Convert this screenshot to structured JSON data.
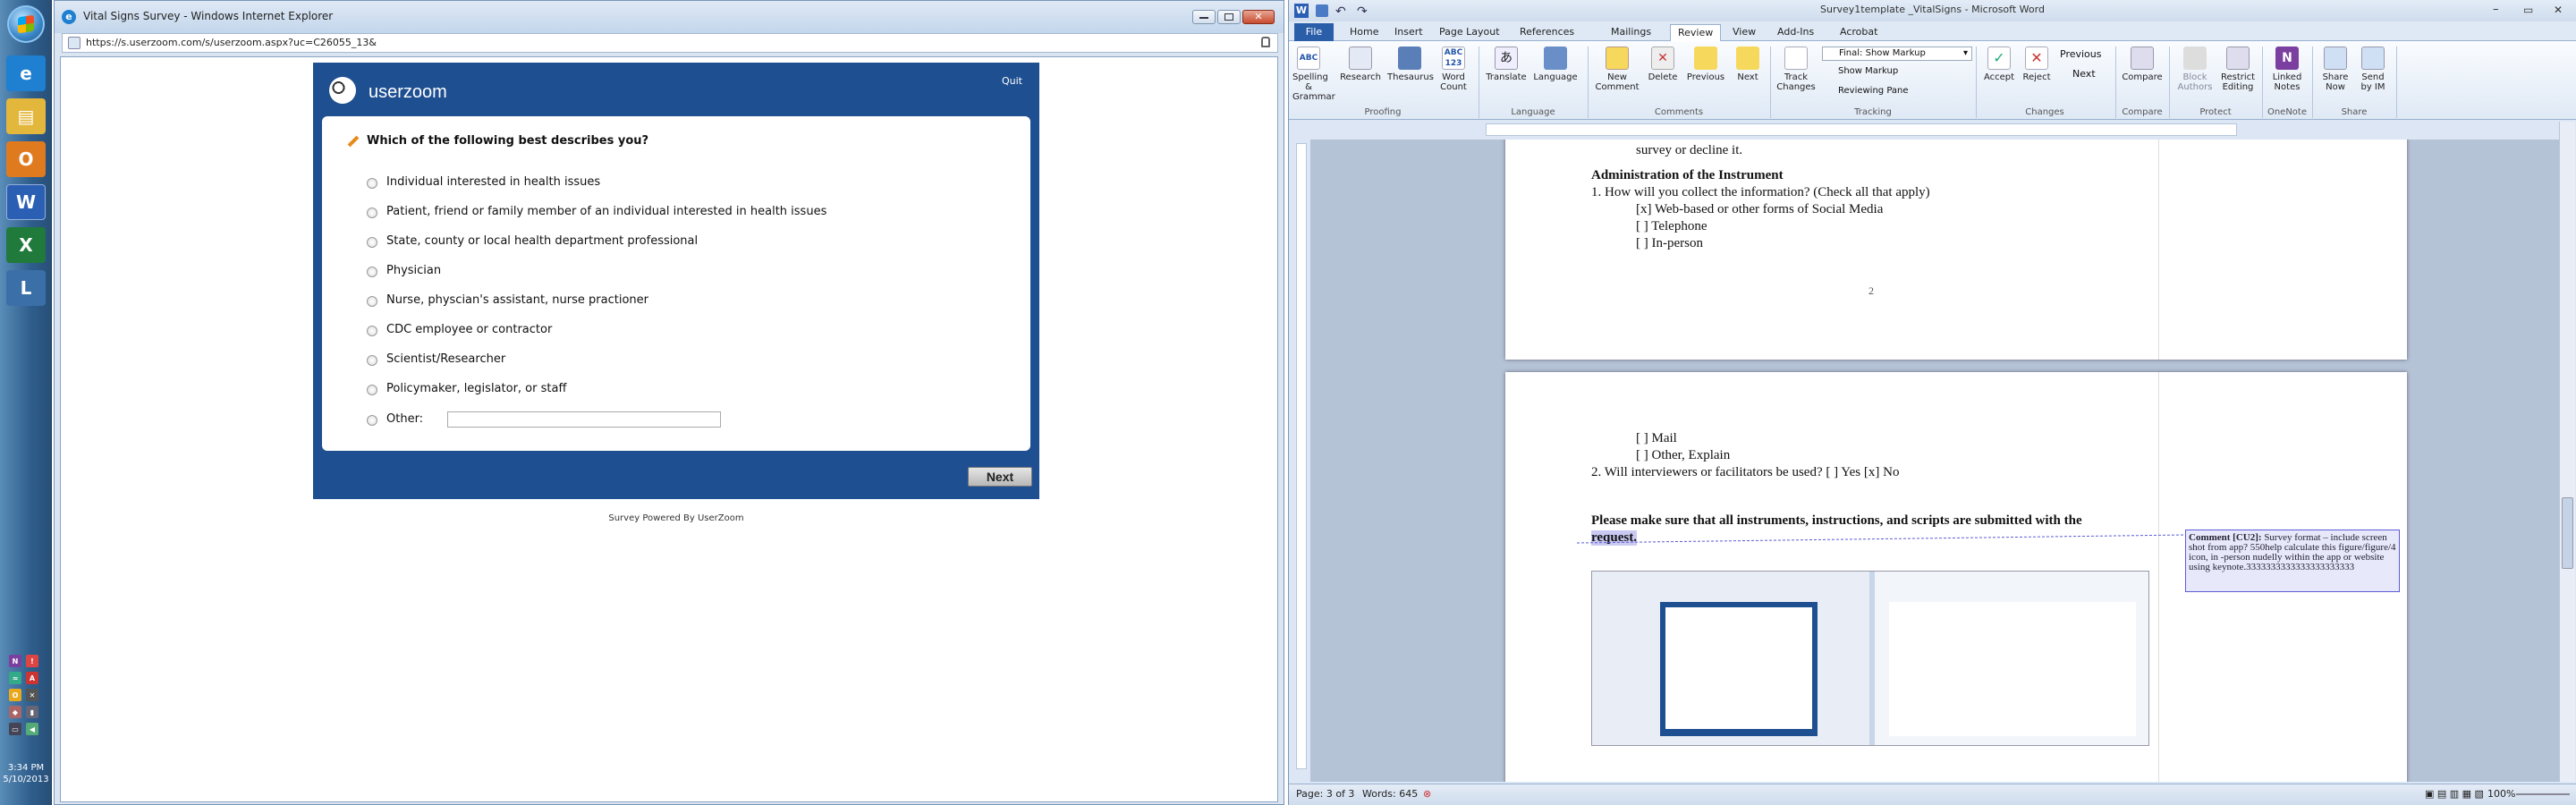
{
  "taskbar": {
    "clock_time": "3:34 PM",
    "clock_date": "5/10/2013"
  },
  "ie": {
    "title": "Vital Signs Survey - Windows Internet Explorer",
    "url": "https://s.userzoom.com/s/userzoom.aspx?uc=C26055_13&",
    "survey": {
      "brand": "userzoom",
      "quit_label": "Quit",
      "question": "Which of the following best describes you?",
      "options": [
        "Individual interested in health issues",
        "Patient, friend or family member of an individual interested in health issues",
        "State, county or local health department professional",
        "Physician",
        "Nurse, physcian's assistant, nurse practioner",
        "CDC employee or contractor",
        "Scientist/Researcher",
        "Policymaker, legislator, or staff"
      ],
      "other_label": "Other:",
      "other_value": "",
      "next_label": "Next",
      "footer": "Survey Powered By UserZoom"
    }
  },
  "word": {
    "title": "Survey1template _VitalSigns - Microsoft Word",
    "file_tab": "File",
    "tabs": [
      "Home",
      "Insert",
      "Page Layout",
      "References",
      "Mailings",
      "Review",
      "View",
      "Add-Ins",
      "Acrobat"
    ],
    "active_tab": "Review",
    "ribbon": {
      "spelling": "Spelling & Grammar",
      "research": "Research",
      "thesaurus": "Thesaurus",
      "word_count": "Word Count",
      "proofing": "Proofing",
      "translate": "Translate",
      "language_btn": "Language",
      "language_grp": "Language",
      "new_comment": "New Comment",
      "delete": "Delete",
      "previous": "Previous",
      "next": "Next",
      "comments": "Comments",
      "track_changes": "Track Changes",
      "final_markup": "Final: Show Markup",
      "show_markup": "Show Markup",
      "reviewing_pane": "Reviewing Pane",
      "tracking": "Tracking",
      "accept": "Accept",
      "reject": "Reject",
      "ch_previous": "Previous",
      "ch_next": "Next",
      "changes": "Changes",
      "compare_btn": "Compare",
      "compare_grp": "Compare",
      "block_authors": "Block Authors",
      "restrict_editing": "Restrict Editing",
      "protect": "Protect",
      "linked_notes": "Linked Notes",
      "onenote": "OneNote",
      "share_now": "Share Now",
      "send_by_im": "Send by IM",
      "share": "Share"
    },
    "doc": {
      "top_fragment": "survey or decline it.",
      "heading": "Administration  of the Instrument",
      "q1": "1.   How will you collect the information? (Check all that apply)",
      "q1_opts": [
        "[x] Web-based or other forms of Social Media",
        "[  ] Telephone",
        "[  ] In-person"
      ],
      "page_num": "2",
      "q1_opts_cont": [
        "[  ] Mail",
        "[  ] Other, Explain"
      ],
      "q2": "2.   Will interviewers  or facilitators be used?  [  ] Yes [x] No",
      "bold_note": "Please make sure that all instruments, instructions, and scripts are submitted with the",
      "bold_note_2": "request.",
      "comment_author": "Comment [CU2]:",
      "comment_text": "Survey format – include screen shot from app? 550help calculate this figure/figure/4 icon, in -person nudelly within the app or website using keynote.3333333333333333333333"
    },
    "status": {
      "page": "Page: 3 of 3",
      "words": "Words: 645",
      "zoom": "100%"
    }
  }
}
